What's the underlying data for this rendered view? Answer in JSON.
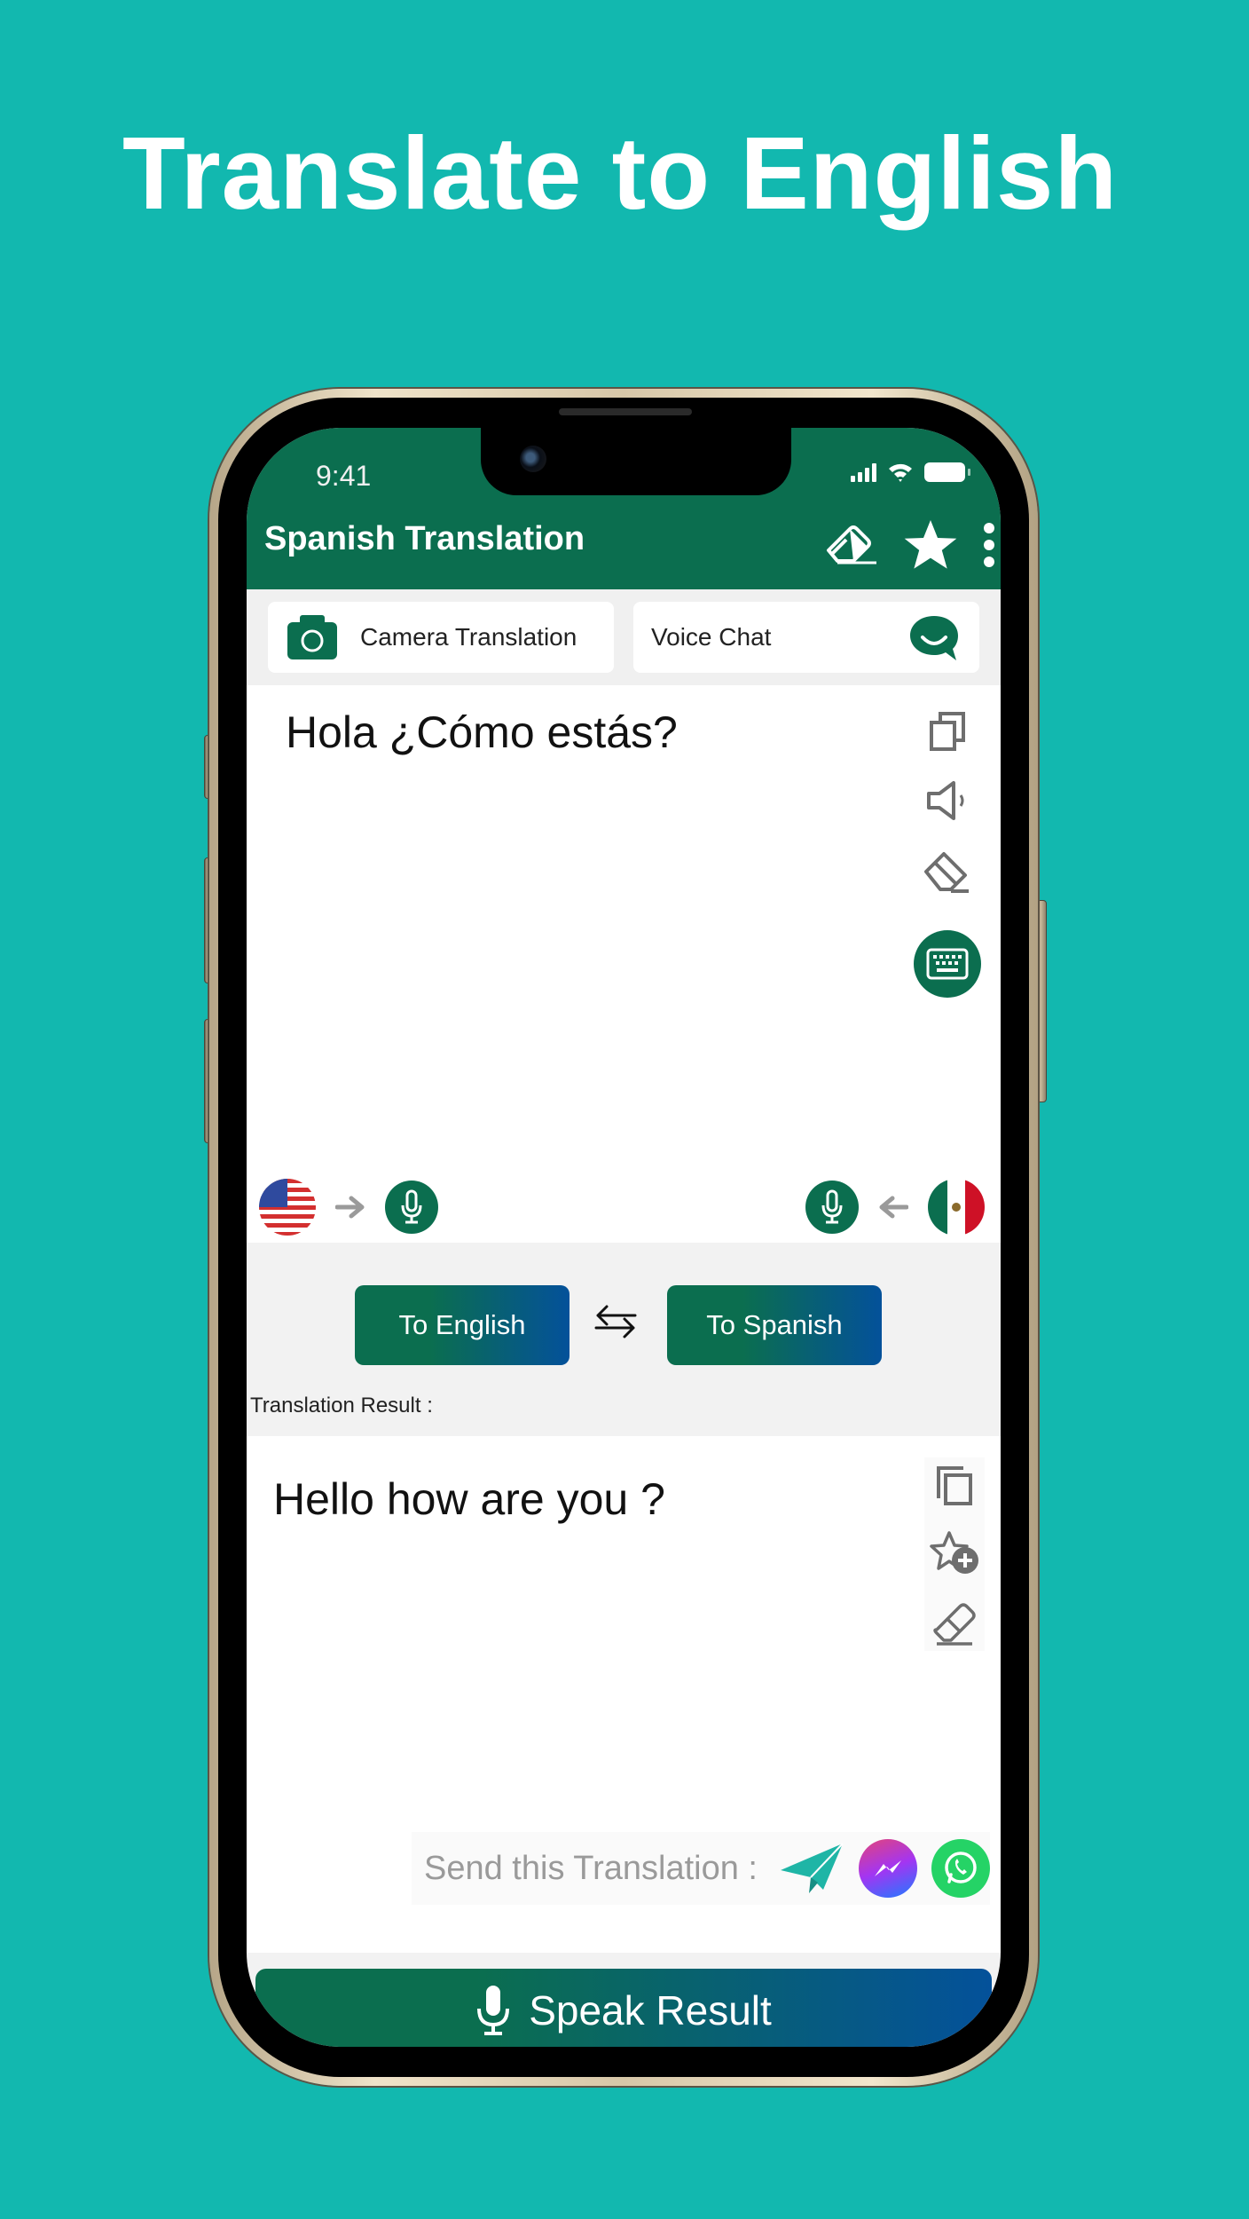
{
  "headline": "Translate to English",
  "colors": {
    "background": "#12b8af",
    "brand_green": "#0b6e4f",
    "brand_blue": "#04519a",
    "telegram": "#1fb5a6",
    "whatsapp": "#25d366"
  },
  "status_bar": {
    "time": "9:41",
    "icons": [
      "signal-icon",
      "wifi-icon",
      "battery-icon"
    ]
  },
  "app_bar": {
    "title": "Spanish Translation",
    "actions": [
      "eraser-icon",
      "star-icon",
      "more-vert-icon"
    ]
  },
  "quick_actions": {
    "camera_label": "Camera Translation",
    "voice_label": "Voice Chat"
  },
  "source": {
    "text": "Hola ¿Cómo estás?",
    "tools": [
      "copy-icon",
      "speaker-icon",
      "eraser-icon",
      "keyboard-icon"
    ]
  },
  "languages": {
    "left_flag": "us-flag",
    "right_flag": "mexico-flag"
  },
  "translate": {
    "to_english_label": "To English",
    "to_spanish_label": "To Spanish",
    "result_label": "Translation Result :"
  },
  "result": {
    "text": "Hello how are you ?",
    "tools": [
      "copy-icon",
      "add-favorite-icon",
      "eraser-icon"
    ]
  },
  "share": {
    "label": "Send this Translation :",
    "targets": [
      "telegram",
      "messenger",
      "whatsapp"
    ]
  },
  "speak": {
    "label": "Speak Result"
  }
}
